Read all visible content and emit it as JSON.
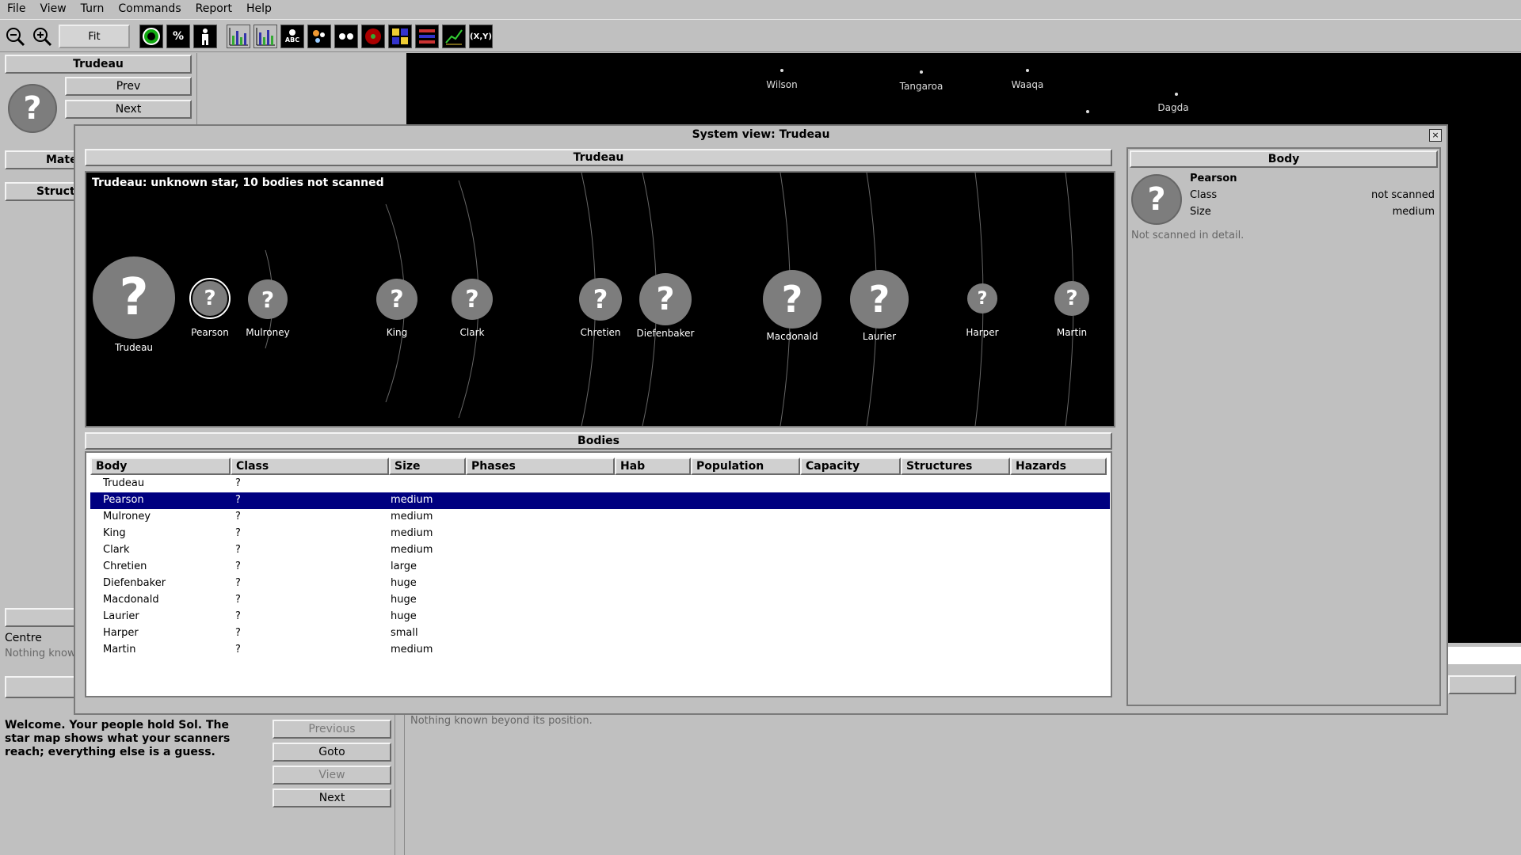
{
  "menu": [
    "File",
    "View",
    "Turn",
    "Commands",
    "Report",
    "Help"
  ],
  "toolbar": {
    "fit_label": "Fit",
    "icons": [
      "zoom-out-icon",
      "zoom-in-icon",
      "fit-button",
      "planet-icon",
      "percent-icon",
      "person-icon",
      "bar-chart-icon",
      "bar-chart-2-icon",
      "abc-label-icon",
      "dots-icon",
      "binary-icon",
      "target-icon",
      "grid-icon",
      "list-icon",
      "line-chart-icon",
      "xy-icon"
    ],
    "percent_text": "%",
    "xy_text": "(X,Y)",
    "abc_text": "ABC"
  },
  "left_panel": {
    "star_name": "Trudeau",
    "prev_label": "Prev",
    "next_label": "Next",
    "mate_label": "Mate",
    "struct_label": "Struct",
    "centre_label": "Centre",
    "nothing_known_short": "Nothing know"
  },
  "map": {
    "stars": [
      {
        "name": "Wilson"
      },
      {
        "name": "Tangaroa"
      },
      {
        "name": "Waaqa"
      },
      {
        "name": "Dagda"
      }
    ]
  },
  "messages": {
    "welcome": "Welcome. Your people hold Sol. The star map shows what your scanners reach; everything else is a guess.",
    "previous_label": "Previous",
    "goto_label": "Goto",
    "view_label": "View",
    "next_label": "Next",
    "detail_text": "Nothing known beyond its position."
  },
  "dialog": {
    "title": "System view: Trudeau",
    "close": "×",
    "system_header": "Trudeau",
    "caption": "Trudeau: unknown star, 10 bodies not scanned",
    "bodies_header": "Bodies",
    "body_panel_header": "Body",
    "glyph": "?",
    "orbit_bodies": [
      {
        "name": "Trudeau"
      },
      {
        "name": "Pearson"
      },
      {
        "name": "Mulroney"
      },
      {
        "name": "King"
      },
      {
        "name": "Clark"
      },
      {
        "name": "Chretien"
      },
      {
        "name": "Diefenbaker"
      },
      {
        "name": "Macdonald"
      },
      {
        "name": "Laurier"
      },
      {
        "name": "Harper"
      },
      {
        "name": "Martin"
      }
    ],
    "columns": [
      "Body",
      "Class",
      "Size",
      "Phases",
      "Hab",
      "Population",
      "Capacity",
      "Structures",
      "Hazards"
    ],
    "rows": [
      {
        "body": "Trudeau",
        "class": "?",
        "size": ""
      },
      {
        "body": "Pearson",
        "class": "?",
        "size": "medium",
        "selected": true
      },
      {
        "body": "Mulroney",
        "class": "?",
        "size": "medium"
      },
      {
        "body": "King",
        "class": "?",
        "size": "medium"
      },
      {
        "body": "Clark",
        "class": "?",
        "size": "medium"
      },
      {
        "body": "Chretien",
        "class": "?",
        "size": "large"
      },
      {
        "body": "Diefenbaker",
        "class": "?",
        "size": "huge"
      },
      {
        "body": "Macdonald",
        "class": "?",
        "size": "huge"
      },
      {
        "body": "Laurier",
        "class": "?",
        "size": "huge"
      },
      {
        "body": "Harper",
        "class": "?",
        "size": "small"
      },
      {
        "body": "Martin",
        "class": "?",
        "size": "medium"
      }
    ],
    "detail": {
      "name": "Pearson",
      "class_label": "Class",
      "class_value": "not scanned",
      "size_label": "Size",
      "size_value": "medium",
      "note": "Not scanned in detail."
    }
  }
}
